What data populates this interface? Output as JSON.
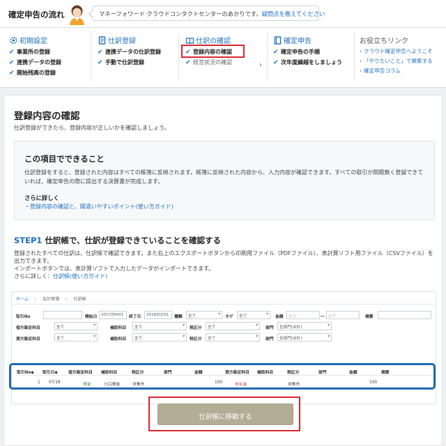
{
  "header": {
    "title": "確定申告の流れ",
    "bubble_text": "マネーフォワード クラウドコンタクトセンターのあかりです。",
    "bubble_link": "疑問点を教えてください"
  },
  "nav": {
    "cols": [
      {
        "title": "初期設定",
        "items": [
          "事業所の登録",
          "連携データの登録",
          "開始残高の登録"
        ]
      },
      {
        "title": "仕訳登録",
        "items": [
          "連携データの仕訳登録",
          "手動で仕訳登録"
        ]
      },
      {
        "title": "仕訳の確認",
        "items": [
          "登録内容の確認",
          "経営状況の確認"
        ]
      },
      {
        "title": "確定申告",
        "items": [
          "確定申告の手順",
          "次年度繰越をしましょう"
        ]
      }
    ],
    "links": {
      "title": "お役立ちリンク",
      "items": [
        "クラウド確定申告へようこそ",
        "「やりたいこと」で検索する",
        "確定申告コラム"
      ]
    }
  },
  "main": {
    "title": "登録内容の確認",
    "subtitle": "仕訳登録ができたら、登録内容が正しいかを確認しましょう。",
    "info": {
      "title": "この項目でできること",
      "text": "仕訳登録をすると、登録された内容はすべての帳簿に反映されます。帳簿に反映された内容から、入力内容が確認できます。すべての取引が問題無く登録できていれば、確定申告の際に提出する決算書が完成します。",
      "more": "さらに詳しく",
      "link": "・登録内容の確認と、間違いやすいポイント(使い方ガイド)"
    },
    "step": {
      "label": "STEP1",
      "title": "仕訳帳で、仕訳が登録できていることを確認する",
      "line1": "登録されたすべての仕訳は、仕訳帳で確認できます。また右上のエクスポートボタンから印刷用ファイル（PDFファイル）、表計算ソフト用ファイル（CSVファイル）を出力できます。",
      "line2": "インポートボタンでは、表計算ソフトで入力したデータがインポートできます。",
      "more": "さらに詳しく：",
      "more_link": "仕訳帳(使い方ガイド)"
    },
    "screenshot": {
      "breadcrumb": [
        "ホーム",
        "会計帳簿",
        "仕訳帳"
      ],
      "filters": {
        "no_label": "取引No",
        "start_label": "開始日",
        "start_value": "2017/04/01",
        "end_label": "終了日",
        "end_value": "2018/03/31",
        "type_label": "種類",
        "type_value": "全て",
        "tag_label": "タグ",
        "tag_value": "全て",
        "amount_label": "金額",
        "amount_from": "以上",
        "amount_tilde": "〜",
        "amount_to": "以下",
        "memo_label": "摘要",
        "debit_label": "借方勘定科目",
        "debit_value": "全て",
        "debit_sub_label": "補助科目",
        "debit_sub_value": "全て",
        "debit_tax_label": "税区分",
        "debit_tax_value": "全て",
        "debit_dept_label": "部門",
        "debit_dept_value": "全部門(合計)",
        "credit_label": "貸方勘定科目",
        "credit_value": "全て",
        "credit_sub_label": "補助科目",
        "credit_sub_value": "全て",
        "credit_tax_label": "税区分",
        "credit_tax_value": "全て",
        "credit_dept_label": "部門",
        "credit_dept_value": "全部門(合計)"
      },
      "table": {
        "headers": [
          "取引No◆",
          "取引日◆",
          "借方勘定科目",
          "補助科目",
          "税区分",
          "部門",
          "金額",
          "貸方勘定科目",
          "補助科目",
          "税区分",
          "部門",
          "金額",
          "摘要"
        ],
        "row": [
          "1",
          "07/18",
          "現金",
          "小口現金",
          "対象外",
          "",
          "100",
          "未払金",
          "",
          "対象外",
          "",
          "100",
          ""
        ]
      }
    },
    "button": "仕訳帳に移動する"
  }
}
